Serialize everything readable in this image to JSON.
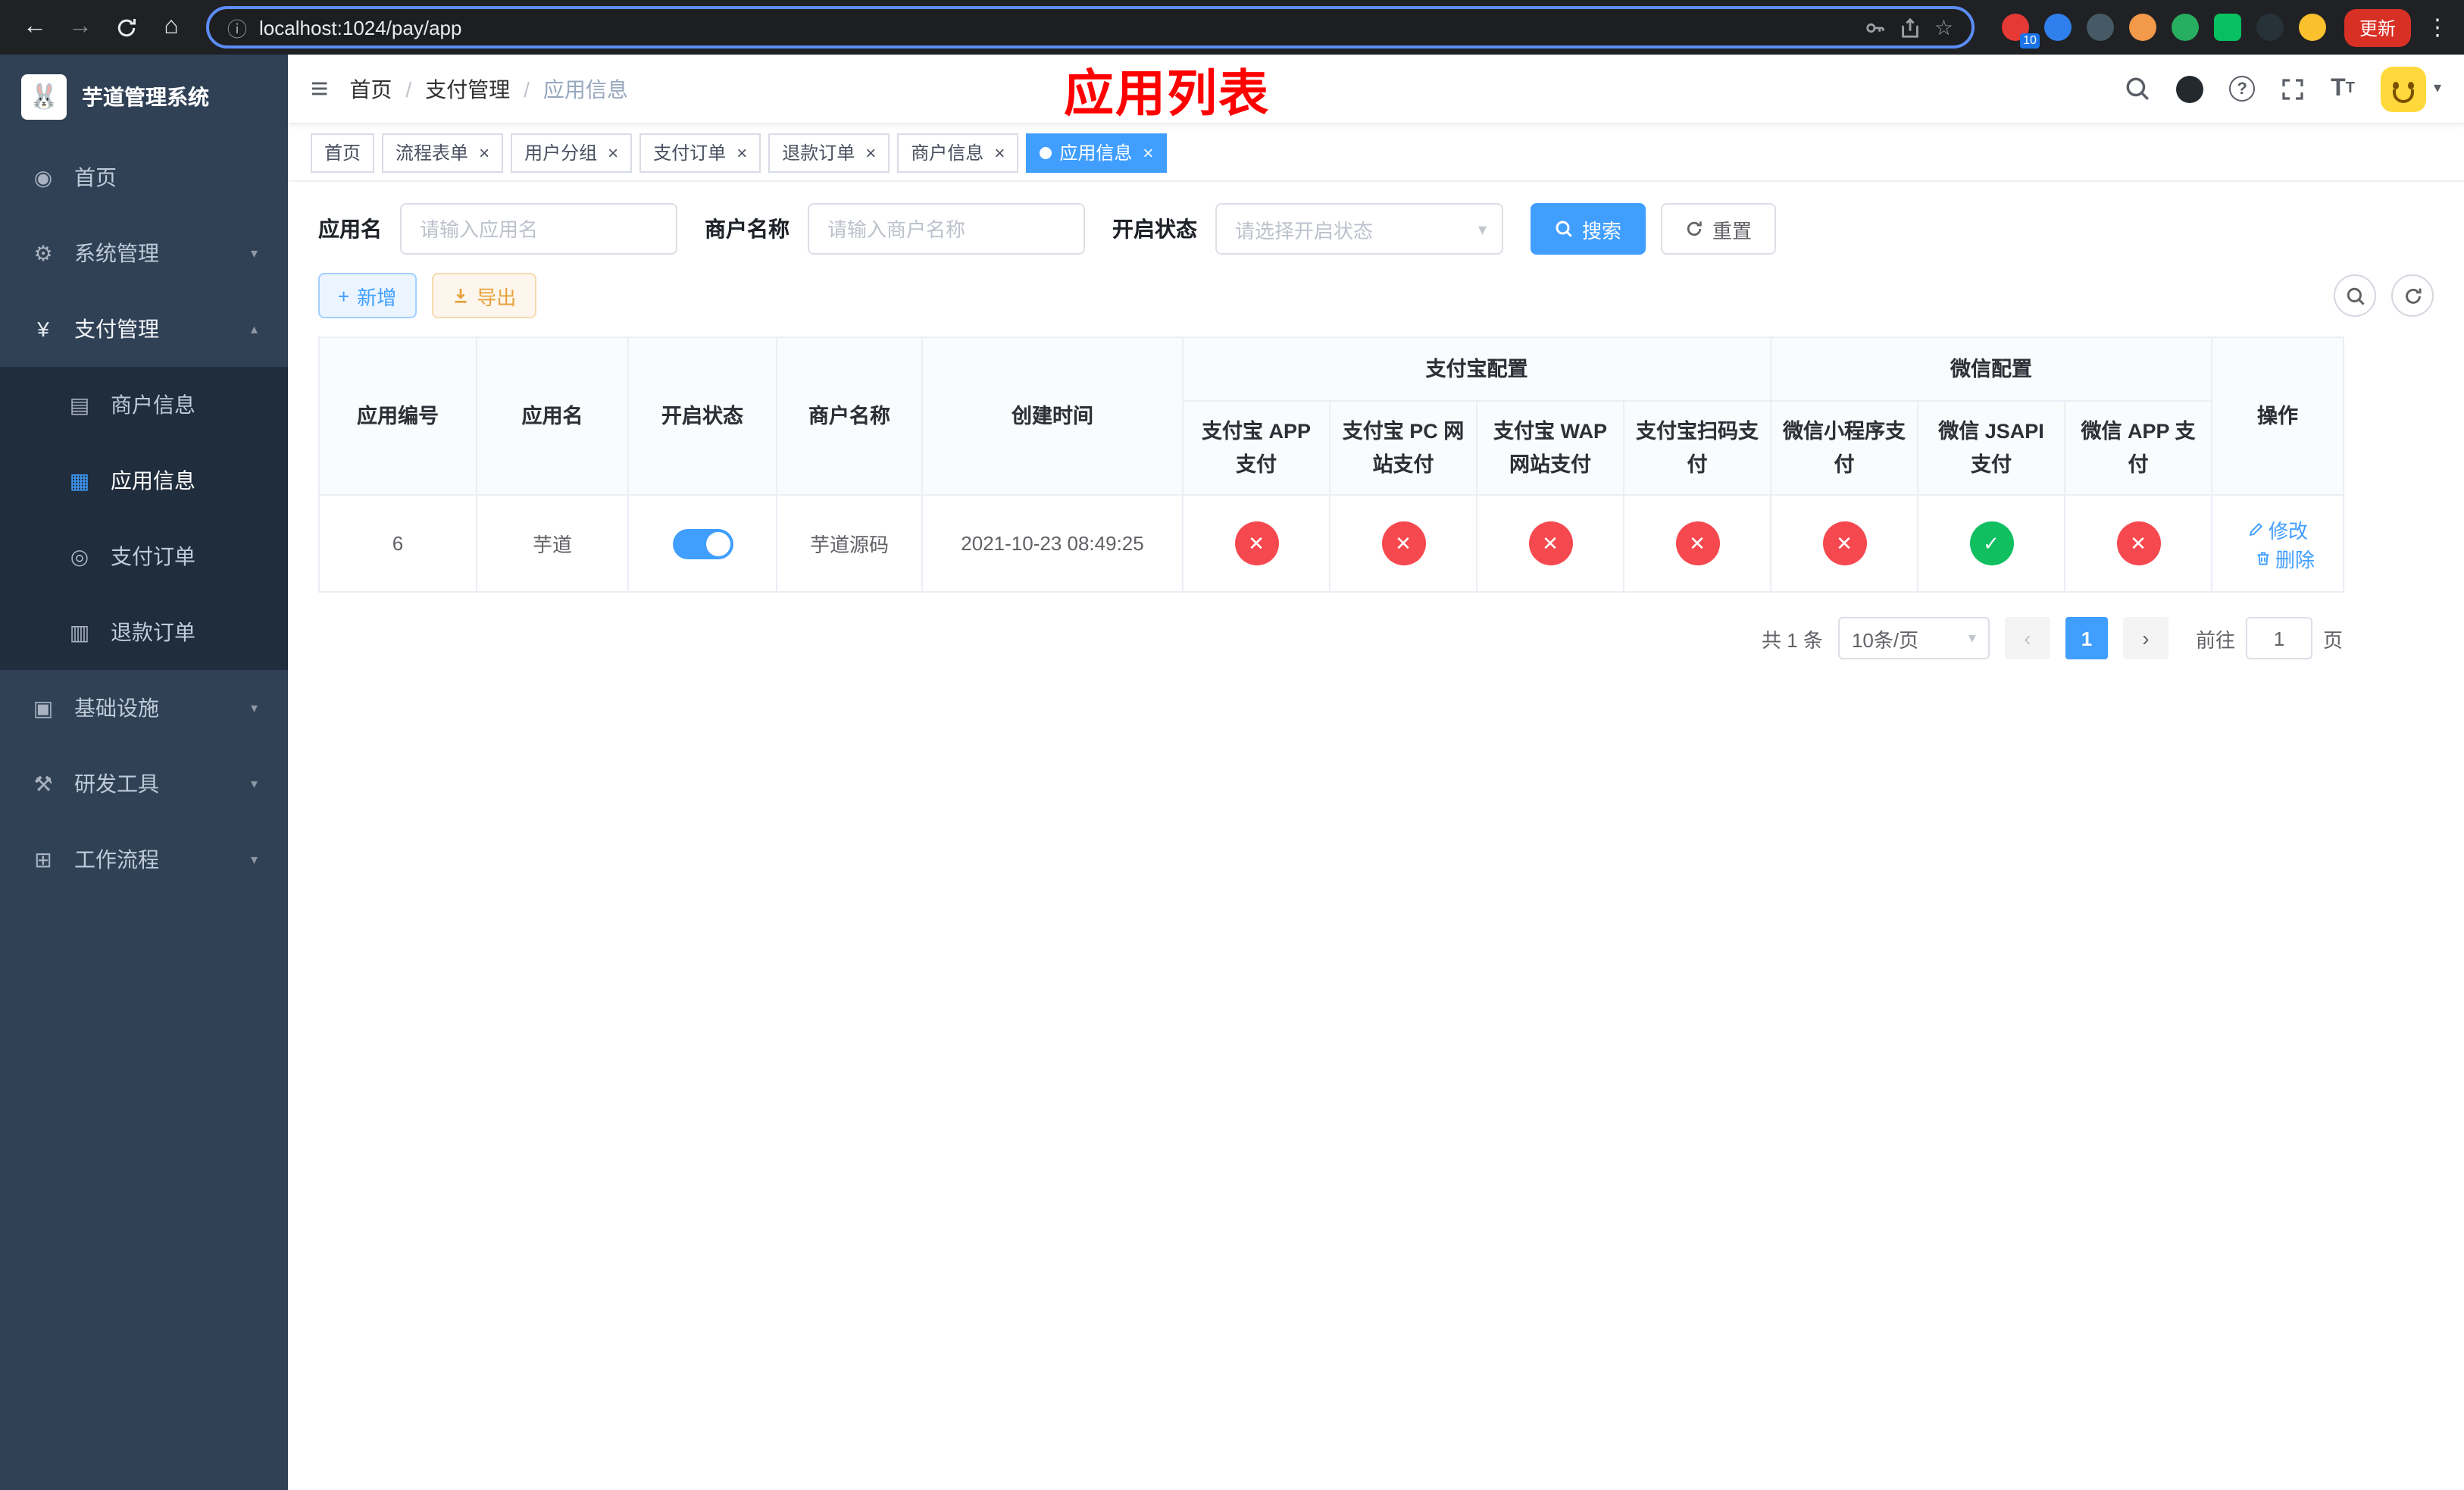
{
  "colors": {
    "primary": "#409eff",
    "success_green": "#0fbf60",
    "danger_red": "#f5494f",
    "annotation_red": "#ff0000",
    "sidebar_bg": "#304156",
    "sidebar_submenu_bg": "#1f2d3d",
    "chrome_bg": "#202124",
    "update_button_bg": "#d93025"
  },
  "browser": {
    "url": "localhost:1024/pay/app",
    "update_label": "更新",
    "extension_badge": "10"
  },
  "icons": {
    "back": "←",
    "forward": "→",
    "home": "⌂",
    "info": "ⓘ",
    "star": "☆",
    "menu_dots": "⋮",
    "close": "×",
    "check": "✓",
    "cross": "✕",
    "caret_down": "▾",
    "chevron_down": "▾",
    "chevron_up": "▴",
    "page_prev": "‹",
    "page_next": "›",
    "hamburger": "≡",
    "plus": "+",
    "help": "?"
  },
  "sidebar": {
    "title": "芋道管理系统",
    "items": [
      {
        "label": "首页",
        "glyph": "◉"
      },
      {
        "label": "系统管理",
        "glyph": "⚙"
      },
      {
        "label": "支付管理",
        "glyph": "¥"
      },
      {
        "label": "基础设施",
        "glyph": "▣"
      },
      {
        "label": "研发工具",
        "glyph": "⚒"
      },
      {
        "label": "工作流程",
        "glyph": "⊞"
      }
    ],
    "payment_children": [
      {
        "label": "商户信息",
        "glyph": "▤"
      },
      {
        "label": "应用信息",
        "glyph": "▦"
      },
      {
        "label": "支付订单",
        "glyph": "◎"
      },
      {
        "label": "退款订单",
        "glyph": "▥"
      }
    ]
  },
  "header": {
    "breadcrumb": [
      "首页",
      "支付管理",
      "应用信息"
    ],
    "separator": "/",
    "annotation": "应用列表"
  },
  "tabs": [
    {
      "label": "首页"
    },
    {
      "label": "流程表单"
    },
    {
      "label": "用户分组"
    },
    {
      "label": "支付订单"
    },
    {
      "label": "退款订单"
    },
    {
      "label": "商户信息"
    },
    {
      "label": "应用信息"
    }
  ],
  "search_form": {
    "app_name_label": "应用名",
    "app_name_placeholder": "请输入应用名",
    "merchant_label": "商户名称",
    "merchant_placeholder": "请输入商户名称",
    "status_label": "开启状态",
    "status_placeholder": "请选择开启状态",
    "search_button": "搜索",
    "reset_button": "重置"
  },
  "toolbar": {
    "add_button": "新增",
    "export_button": "导出"
  },
  "table": {
    "group_headers": {
      "alipay": "支付宝配置",
      "wechat": "微信配置"
    },
    "columns": {
      "app_id": "应用编号",
      "app_name": "应用名",
      "status": "开启状态",
      "merchant": "商户名称",
      "create_time": "创建时间",
      "ops": "操作"
    },
    "alipay_columns": [
      "支付宝 APP 支付",
      "支付宝 PC 网站支付",
      "支付宝 WAP 网站支付",
      "支付宝扫码支付"
    ],
    "wechat_columns": [
      "微信小程序支付",
      "微信 JSAPI 支付",
      "微信 APP 支付"
    ],
    "rows": [
      {
        "id": "6",
        "app_name": "芋道",
        "status_on": true,
        "merchant_name": "芋道源码",
        "create_time": "2021-10-23 08:49:25",
        "channels": {
          "alipay_app": false,
          "alipay_pc": false,
          "alipay_wap": false,
          "alipay_scan": false,
          "wechat_mini": false,
          "wechat_jsapi": true,
          "wechat_app": false
        },
        "edit_label": "修改",
        "delete_label": "删除"
      }
    ]
  },
  "pagination": {
    "total": "共 1 条",
    "page_size": "10条/页",
    "current_page": "1",
    "goto_label": "前往",
    "goto_value": "1",
    "goto_suffix": "页"
  }
}
